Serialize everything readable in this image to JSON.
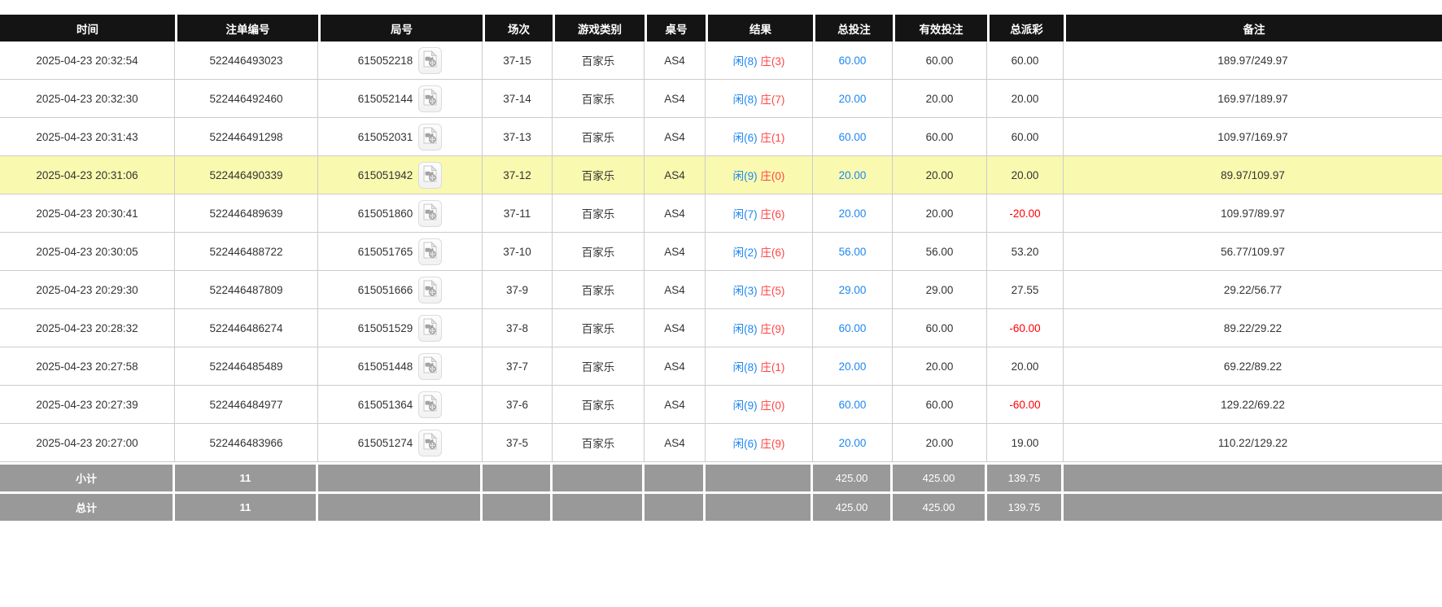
{
  "colors": {
    "header_bg": "#141414",
    "highlight_bg": "#f9f9b0",
    "summary_bg": "#999999",
    "blue": "#1e87f0",
    "banker_red": "#ff4444",
    "negative_red": "#ff0000",
    "border_color": "#cccccc",
    "text_color": "#333333"
  },
  "icons": {
    "round_action": "video-replay-icon"
  },
  "table": {
    "columns": [
      {
        "key": "time",
        "label": "时间"
      },
      {
        "key": "bet_id",
        "label": "注单编号"
      },
      {
        "key": "round_id",
        "label": "局号"
      },
      {
        "key": "session",
        "label": "场次"
      },
      {
        "key": "game_type",
        "label": "游戏类别"
      },
      {
        "key": "table_no",
        "label": "桌号"
      },
      {
        "key": "result",
        "label": "结果"
      },
      {
        "key": "total_bet",
        "label": "总投注"
      },
      {
        "key": "valid_bet",
        "label": "有效投注"
      },
      {
        "key": "total_payout",
        "label": "总派彩"
      },
      {
        "key": "note",
        "label": "备注"
      }
    ],
    "rows": [
      {
        "time": "2025-04-23 20:32:54",
        "bet_id": "522446493023",
        "round_id": "615052218",
        "session": "37-15",
        "game_type": "百家乐",
        "table_no": "AS4",
        "result_player": "闲(8)",
        "result_banker": "庄(3)",
        "total_bet": "60.00",
        "valid_bet": "60.00",
        "total_payout": "60.00",
        "note": "189.97/249.97",
        "highlighted": false
      },
      {
        "time": "2025-04-23 20:32:30",
        "bet_id": "522446492460",
        "round_id": "615052144",
        "session": "37-14",
        "game_type": "百家乐",
        "table_no": "AS4",
        "result_player": "闲(8)",
        "result_banker": "庄(7)",
        "total_bet": "20.00",
        "valid_bet": "20.00",
        "total_payout": "20.00",
        "note": "169.97/189.97",
        "highlighted": false
      },
      {
        "time": "2025-04-23 20:31:43",
        "bet_id": "522446491298",
        "round_id": "615052031",
        "session": "37-13",
        "game_type": "百家乐",
        "table_no": "AS4",
        "result_player": "闲(6)",
        "result_banker": "庄(1)",
        "total_bet": "60.00",
        "valid_bet": "60.00",
        "total_payout": "60.00",
        "note": "109.97/169.97",
        "highlighted": false
      },
      {
        "time": "2025-04-23 20:31:06",
        "bet_id": "522446490339",
        "round_id": "615051942",
        "session": "37-12",
        "game_type": "百家乐",
        "table_no": "AS4",
        "result_player": "闲(9)",
        "result_banker": "庄(0)",
        "total_bet": "20.00",
        "valid_bet": "20.00",
        "total_payout": "20.00",
        "note": "89.97/109.97",
        "highlighted": true
      },
      {
        "time": "2025-04-23 20:30:41",
        "bet_id": "522446489639",
        "round_id": "615051860",
        "session": "37-11",
        "game_type": "百家乐",
        "table_no": "AS4",
        "result_player": "闲(7)",
        "result_banker": "庄(6)",
        "total_bet": "20.00",
        "valid_bet": "20.00",
        "total_payout": "-20.00",
        "note": "109.97/89.97",
        "highlighted": false
      },
      {
        "time": "2025-04-23 20:30:05",
        "bet_id": "522446488722",
        "round_id": "615051765",
        "session": "37-10",
        "game_type": "百家乐",
        "table_no": "AS4",
        "result_player": "闲(2)",
        "result_banker": "庄(6)",
        "total_bet": "56.00",
        "valid_bet": "56.00",
        "total_payout": "53.20",
        "note": "56.77/109.97",
        "highlighted": false
      },
      {
        "time": "2025-04-23 20:29:30",
        "bet_id": "522446487809",
        "round_id": "615051666",
        "session": "37-9",
        "game_type": "百家乐",
        "table_no": "AS4",
        "result_player": "闲(3)",
        "result_banker": "庄(5)",
        "total_bet": "29.00",
        "valid_bet": "29.00",
        "total_payout": "27.55",
        "note": "29.22/56.77",
        "highlighted": false
      },
      {
        "time": "2025-04-23 20:28:32",
        "bet_id": "522446486274",
        "round_id": "615051529",
        "session": "37-8",
        "game_type": "百家乐",
        "table_no": "AS4",
        "result_player": "闲(8)",
        "result_banker": "庄(9)",
        "total_bet": "60.00",
        "valid_bet": "60.00",
        "total_payout": "-60.00",
        "note": "89.22/29.22",
        "highlighted": false
      },
      {
        "time": "2025-04-23 20:27:58",
        "bet_id": "522446485489",
        "round_id": "615051448",
        "session": "37-7",
        "game_type": "百家乐",
        "table_no": "AS4",
        "result_player": "闲(8)",
        "result_banker": "庄(1)",
        "total_bet": "20.00",
        "valid_bet": "20.00",
        "total_payout": "20.00",
        "note": "69.22/89.22",
        "highlighted": false
      },
      {
        "time": "2025-04-23 20:27:39",
        "bet_id": "522446484977",
        "round_id": "615051364",
        "session": "37-6",
        "game_type": "百家乐",
        "table_no": "AS4",
        "result_player": "闲(9)",
        "result_banker": "庄(0)",
        "total_bet": "60.00",
        "valid_bet": "60.00",
        "total_payout": "-60.00",
        "note": "129.22/69.22",
        "highlighted": false
      },
      {
        "time": "2025-04-23 20:27:00",
        "bet_id": "522446483966",
        "round_id": "615051274",
        "session": "37-5",
        "game_type": "百家乐",
        "table_no": "AS4",
        "result_player": "闲(6)",
        "result_banker": "庄(9)",
        "total_bet": "20.00",
        "valid_bet": "20.00",
        "total_payout": "19.00",
        "note": "110.22/129.22",
        "highlighted": false
      }
    ],
    "subtotal": {
      "label": "小计",
      "count": "11",
      "total_bet": "425.00",
      "valid_bet": "425.00",
      "total_payout": "139.75"
    },
    "total": {
      "label": "总计",
      "count": "11",
      "total_bet": "425.00",
      "valid_bet": "425.00",
      "total_payout": "139.75"
    }
  }
}
